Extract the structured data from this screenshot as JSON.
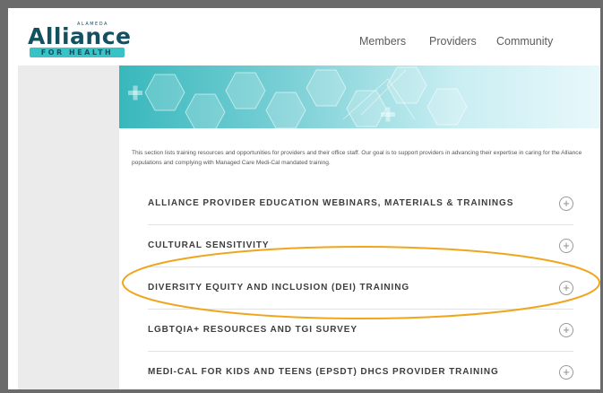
{
  "logo": {
    "top_text": "ALAMEDA",
    "main_text": "Alliance",
    "bar_text": "FOR HEALTH"
  },
  "nav": {
    "items": [
      "Members",
      "Providers",
      "Community"
    ]
  },
  "intro": "This section lists training resources and opportunities for providers and their office staff. Our goal is to support providers in advancing their expertise in caring for the Alliance populations and complying with Managed Care Medi-Cal mandated training.",
  "accordion": [
    {
      "title": "ALLIANCE PROVIDER EDUCATION WEBINARS, MATERIALS & TRAININGS",
      "icon": "plus-circle-icon"
    },
    {
      "title": "CULTURAL SENSITIVITY",
      "icon": "plus-circle-icon"
    },
    {
      "title": "DIVERSITY EQUITY AND INCLUSION (DEI) TRAINING",
      "icon": "plus-circle-icon"
    },
    {
      "title": "LGBTQIA+ RESOURCES AND TGI SURVEY",
      "icon": "plus-circle-icon"
    },
    {
      "title": "MEDI-CAL FOR KIDS AND TEENS (EPSDT) DHCS PROVIDER TRAINING",
      "icon": "plus-circle-icon"
    }
  ],
  "plus_symbol": "+",
  "colors": {
    "brand_dark": "#14505f",
    "brand_teal": "#39c3c7",
    "annotation_orange": "#f0a51d",
    "frame_gray": "#6b6b6b"
  }
}
